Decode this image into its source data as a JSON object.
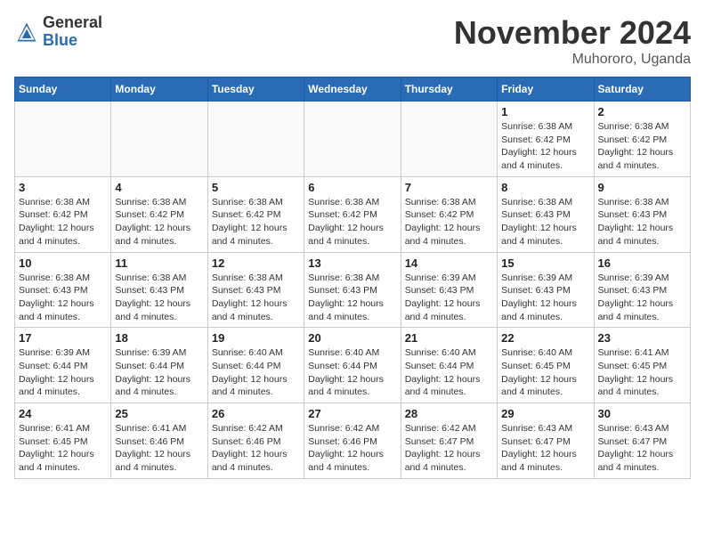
{
  "logo": {
    "general": "General",
    "blue": "Blue"
  },
  "title": "November 2024",
  "location": "Muhororo, Uganda",
  "days_header": [
    "Sunday",
    "Monday",
    "Tuesday",
    "Wednesday",
    "Thursday",
    "Friday",
    "Saturday"
  ],
  "weeks": [
    [
      {
        "day": "",
        "info": ""
      },
      {
        "day": "",
        "info": ""
      },
      {
        "day": "",
        "info": ""
      },
      {
        "day": "",
        "info": ""
      },
      {
        "day": "",
        "info": ""
      },
      {
        "day": "1",
        "info": "Sunrise: 6:38 AM\nSunset: 6:42 PM\nDaylight: 12 hours and 4 minutes."
      },
      {
        "day": "2",
        "info": "Sunrise: 6:38 AM\nSunset: 6:42 PM\nDaylight: 12 hours and 4 minutes."
      }
    ],
    [
      {
        "day": "3",
        "info": "Sunrise: 6:38 AM\nSunset: 6:42 PM\nDaylight: 12 hours and 4 minutes."
      },
      {
        "day": "4",
        "info": "Sunrise: 6:38 AM\nSunset: 6:42 PM\nDaylight: 12 hours and 4 minutes."
      },
      {
        "day": "5",
        "info": "Sunrise: 6:38 AM\nSunset: 6:42 PM\nDaylight: 12 hours and 4 minutes."
      },
      {
        "day": "6",
        "info": "Sunrise: 6:38 AM\nSunset: 6:42 PM\nDaylight: 12 hours and 4 minutes."
      },
      {
        "day": "7",
        "info": "Sunrise: 6:38 AM\nSunset: 6:42 PM\nDaylight: 12 hours and 4 minutes."
      },
      {
        "day": "8",
        "info": "Sunrise: 6:38 AM\nSunset: 6:43 PM\nDaylight: 12 hours and 4 minutes."
      },
      {
        "day": "9",
        "info": "Sunrise: 6:38 AM\nSunset: 6:43 PM\nDaylight: 12 hours and 4 minutes."
      }
    ],
    [
      {
        "day": "10",
        "info": "Sunrise: 6:38 AM\nSunset: 6:43 PM\nDaylight: 12 hours and 4 minutes."
      },
      {
        "day": "11",
        "info": "Sunrise: 6:38 AM\nSunset: 6:43 PM\nDaylight: 12 hours and 4 minutes."
      },
      {
        "day": "12",
        "info": "Sunrise: 6:38 AM\nSunset: 6:43 PM\nDaylight: 12 hours and 4 minutes."
      },
      {
        "day": "13",
        "info": "Sunrise: 6:38 AM\nSunset: 6:43 PM\nDaylight: 12 hours and 4 minutes."
      },
      {
        "day": "14",
        "info": "Sunrise: 6:39 AM\nSunset: 6:43 PM\nDaylight: 12 hours and 4 minutes."
      },
      {
        "day": "15",
        "info": "Sunrise: 6:39 AM\nSunset: 6:43 PM\nDaylight: 12 hours and 4 minutes."
      },
      {
        "day": "16",
        "info": "Sunrise: 6:39 AM\nSunset: 6:43 PM\nDaylight: 12 hours and 4 minutes."
      }
    ],
    [
      {
        "day": "17",
        "info": "Sunrise: 6:39 AM\nSunset: 6:44 PM\nDaylight: 12 hours and 4 minutes."
      },
      {
        "day": "18",
        "info": "Sunrise: 6:39 AM\nSunset: 6:44 PM\nDaylight: 12 hours and 4 minutes."
      },
      {
        "day": "19",
        "info": "Sunrise: 6:40 AM\nSunset: 6:44 PM\nDaylight: 12 hours and 4 minutes."
      },
      {
        "day": "20",
        "info": "Sunrise: 6:40 AM\nSunset: 6:44 PM\nDaylight: 12 hours and 4 minutes."
      },
      {
        "day": "21",
        "info": "Sunrise: 6:40 AM\nSunset: 6:44 PM\nDaylight: 12 hours and 4 minutes."
      },
      {
        "day": "22",
        "info": "Sunrise: 6:40 AM\nSunset: 6:45 PM\nDaylight: 12 hours and 4 minutes."
      },
      {
        "day": "23",
        "info": "Sunrise: 6:41 AM\nSunset: 6:45 PM\nDaylight: 12 hours and 4 minutes."
      }
    ],
    [
      {
        "day": "24",
        "info": "Sunrise: 6:41 AM\nSunset: 6:45 PM\nDaylight: 12 hours and 4 minutes."
      },
      {
        "day": "25",
        "info": "Sunrise: 6:41 AM\nSunset: 6:46 PM\nDaylight: 12 hours and 4 minutes."
      },
      {
        "day": "26",
        "info": "Sunrise: 6:42 AM\nSunset: 6:46 PM\nDaylight: 12 hours and 4 minutes."
      },
      {
        "day": "27",
        "info": "Sunrise: 6:42 AM\nSunset: 6:46 PM\nDaylight: 12 hours and 4 minutes."
      },
      {
        "day": "28",
        "info": "Sunrise: 6:42 AM\nSunset: 6:47 PM\nDaylight: 12 hours and 4 minutes."
      },
      {
        "day": "29",
        "info": "Sunrise: 6:43 AM\nSunset: 6:47 PM\nDaylight: 12 hours and 4 minutes."
      },
      {
        "day": "30",
        "info": "Sunrise: 6:43 AM\nSunset: 6:47 PM\nDaylight: 12 hours and 4 minutes."
      }
    ]
  ]
}
